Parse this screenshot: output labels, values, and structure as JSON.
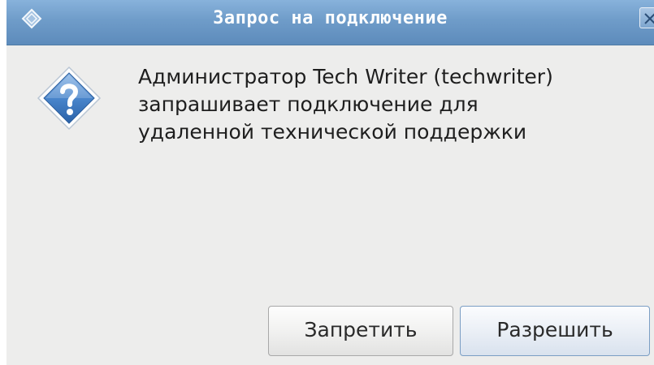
{
  "window": {
    "title": "Запрос на подключение",
    "icons": {
      "title_icon": "app-diamond-icon",
      "close_icon": "close-icon",
      "message_icon": "question-icon"
    }
  },
  "message": {
    "lines": [
      "Администратор Tech Writer (techwriter)",
      "запрашивает подключение для",
      "удаленной технической поддержки"
    ]
  },
  "buttons": {
    "deny_label": "Запретить",
    "allow_label": "Разрешить"
  },
  "colors": {
    "titlebar": "#6f9cc9",
    "background": "#ededec",
    "icon_blue": "#3b78c2"
  }
}
